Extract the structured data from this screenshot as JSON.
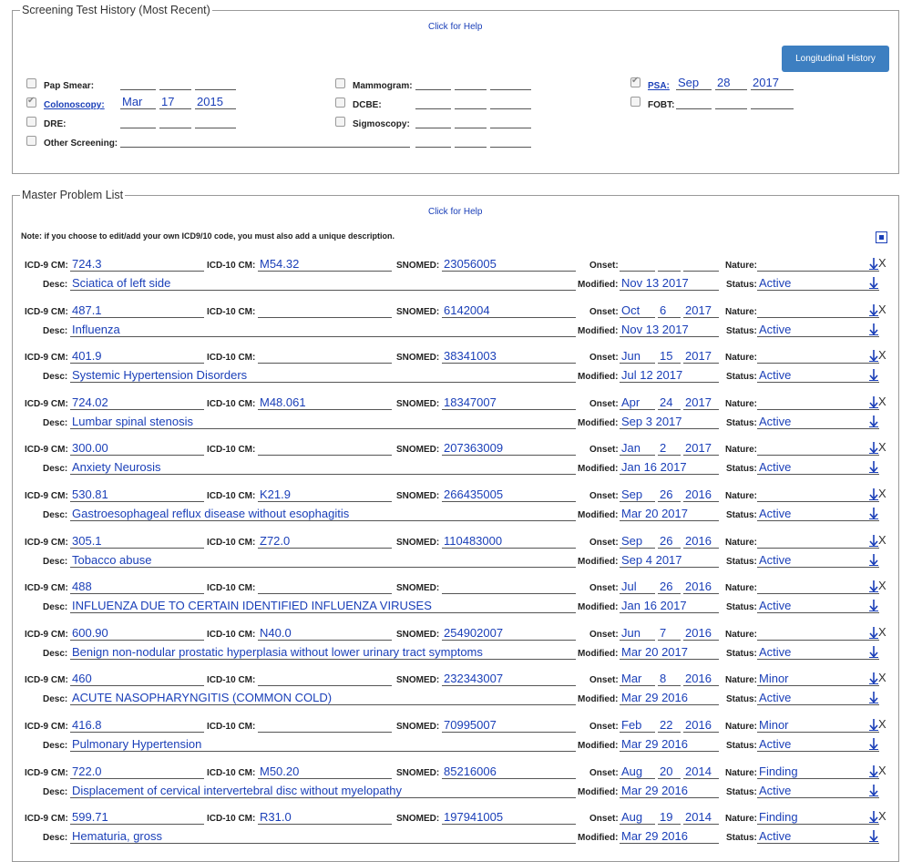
{
  "screening": {
    "legend": "Screening Test History (Most Recent)",
    "help": "Click for Help",
    "longitudinal_button": "Longitudinal History",
    "pap_smear": "Pap Smear:",
    "colonoscopy": "Colonoscopy:",
    "colonoscopy_month": "Mar",
    "colonoscopy_day": "17",
    "colonoscopy_year": "2015",
    "dre": "DRE:",
    "other": "Other Screening:",
    "mammogram": "Mammogram:",
    "dcbe": "DCBE:",
    "sigmoscopy": "Sigmoscopy:",
    "psa": "PSA:",
    "psa_month": "Sep",
    "psa_day": "28",
    "psa_year": "2017",
    "fobt": "FOBT:"
  },
  "problems": {
    "legend": "Master Problem List",
    "help": "Click for Help",
    "note": "Note: if you choose to edit/add your own ICD9/10 code, you must also add a unique description.",
    "labels": {
      "icd9": "ICD-9 CM:",
      "icd10": "ICD-10 CM:",
      "snomed": "SNOMED:",
      "onset": "Onset:",
      "nature": "Nature:",
      "desc": "Desc:",
      "modified": "Modified:",
      "status": "Status:",
      "remove": "X"
    },
    "rows": [
      {
        "icd9": "724.3",
        "icd10": "M54.32",
        "snomed": "23056005",
        "onset_m": "",
        "onset_d": "",
        "onset_y": "",
        "nature": "",
        "desc": "Sciatica of left side",
        "modified": "Nov 13 2017",
        "status": "Active"
      },
      {
        "icd9": "487.1",
        "icd10": "",
        "snomed": "6142004",
        "onset_m": "Oct",
        "onset_d": "6",
        "onset_y": "2017",
        "nature": "",
        "desc": "Influenza",
        "modified": "Nov 13 2017",
        "status": "Active"
      },
      {
        "icd9": "401.9",
        "icd10": "",
        "snomed": "38341003",
        "onset_m": "Jun",
        "onset_d": "15",
        "onset_y": "2017",
        "nature": "",
        "desc": "Systemic Hypertension Disorders",
        "modified": "Jul 12 2017",
        "status": "Active"
      },
      {
        "icd9": "724.02",
        "icd10": "M48.061",
        "snomed": "18347007",
        "onset_m": "Apr",
        "onset_d": "24",
        "onset_y": "2017",
        "nature": "",
        "desc": "Lumbar spinal stenosis",
        "modified": "Sep 3 2017",
        "status": "Active"
      },
      {
        "icd9": "300.00",
        "icd10": "",
        "snomed": "207363009",
        "onset_m": "Jan",
        "onset_d": "2",
        "onset_y": "2017",
        "nature": "",
        "desc": "Anxiety Neurosis",
        "modified": "Jan 16 2017",
        "status": "Active"
      },
      {
        "icd9": "530.81",
        "icd10": "K21.9",
        "snomed": "266435005",
        "onset_m": "Sep",
        "onset_d": "26",
        "onset_y": "2016",
        "nature": "",
        "desc": "Gastroesophageal reflux disease without esophagitis",
        "modified": "Mar 20 2017",
        "status": "Active"
      },
      {
        "icd9": "305.1",
        "icd10": "Z72.0",
        "snomed": "110483000",
        "onset_m": "Sep",
        "onset_d": "26",
        "onset_y": "2016",
        "nature": "",
        "desc": "Tobacco abuse",
        "modified": "Sep 4 2017",
        "status": "Active"
      },
      {
        "icd9": "488",
        "icd10": "",
        "snomed": "",
        "onset_m": "Jul",
        "onset_d": "26",
        "onset_y": "2016",
        "nature": "",
        "desc": "INFLUENZA DUE TO CERTAIN IDENTIFIED INFLUENZA VIRUSES",
        "modified": "Jan 16 2017",
        "status": "Active"
      },
      {
        "icd9": "600.90",
        "icd10": "N40.0",
        "snomed": "254902007",
        "onset_m": "Jun",
        "onset_d": "7",
        "onset_y": "2016",
        "nature": "",
        "desc": "Benign non-nodular prostatic hyperplasia without lower urinary tract symptoms",
        "modified": "Mar 20 2017",
        "status": "Active"
      },
      {
        "icd9": "460",
        "icd10": "",
        "snomed": "232343007",
        "onset_m": "Mar",
        "onset_d": "8",
        "onset_y": "2016",
        "nature": "Minor",
        "desc": "ACUTE NASOPHARYNGITIS (COMMON COLD)",
        "modified": "Mar 29 2016",
        "status": "Active"
      },
      {
        "icd9": "416.8",
        "icd10": "",
        "snomed": "70995007",
        "onset_m": "Feb",
        "onset_d": "22",
        "onset_y": "2016",
        "nature": "Minor",
        "desc": "Pulmonary Hypertension",
        "modified": "Mar 29 2016",
        "status": "Active"
      },
      {
        "icd9": "722.0",
        "icd10": "M50.20",
        "snomed": "85216006",
        "onset_m": "Aug",
        "onset_d": "20",
        "onset_y": "2014",
        "nature": "Finding",
        "desc": "Displacement of cervical intervertebral disc without myelopathy",
        "modified": "Mar 29 2016",
        "status": "Active"
      },
      {
        "icd9": "599.71",
        "icd10": "R31.0",
        "snomed": "197941005",
        "onset_m": "Aug",
        "onset_d": "19",
        "onset_y": "2014",
        "nature": "Finding",
        "desc": "Hematuria, gross",
        "modified": "Mar 29 2016",
        "status": "Active"
      }
    ]
  }
}
